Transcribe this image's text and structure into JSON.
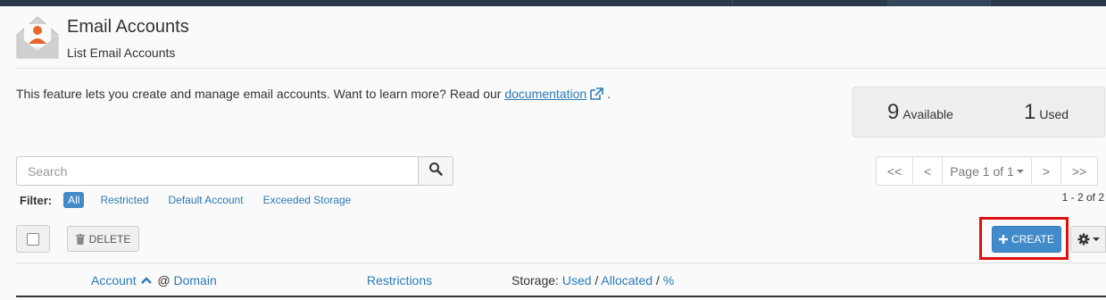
{
  "header": {
    "title": "Email Accounts",
    "subtitle": "List Email Accounts"
  },
  "intro": {
    "text": "This feature lets you create and manage email accounts. Want to learn more? Read our",
    "link_label": "documentation",
    "suffix": "."
  },
  "stats": {
    "available_count": "9",
    "available_label": "Available",
    "used_count": "1",
    "used_label": "Used"
  },
  "search": {
    "placeholder": "Search"
  },
  "pagination": {
    "first": "<<",
    "prev": "<",
    "page_label": "Page 1 of 1",
    "next": ">",
    "last": ">>",
    "count": "1 - 2 of 2"
  },
  "filter": {
    "label": "Filter:",
    "options": [
      "All",
      "Restricted",
      "Default Account",
      "Exceeded Storage"
    ]
  },
  "toolbar": {
    "delete_label": "DELETE",
    "create_label": "CREATE"
  },
  "table": {
    "col_account": "Account",
    "col_at": "@",
    "col_domain": "Domain",
    "col_restrictions": "Restrictions",
    "col_storage_prefix": "Storage:",
    "col_storage_used": "Used",
    "col_storage_sep": "/",
    "col_storage_allocated": "Allocated",
    "col_storage_percent": "%"
  },
  "colors": {
    "accent": "#428bca",
    "link": "#2a7ab8",
    "highlight": "#e01010",
    "topbar": "#293a4a"
  }
}
